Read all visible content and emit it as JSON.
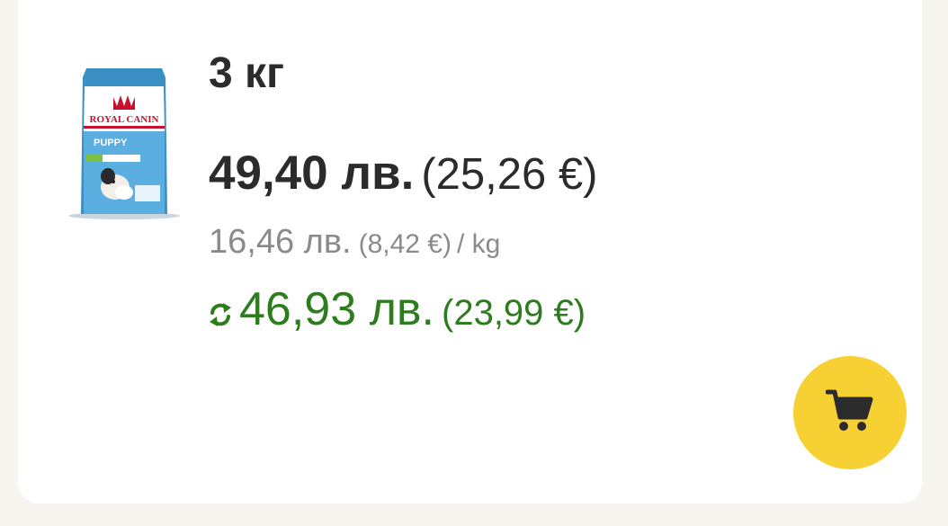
{
  "product": {
    "image_icon": "royal-canin-puppy-bag-image",
    "brand_text": "ROYAL CANIN",
    "bag_label": "PUPPY",
    "size": "3 кг"
  },
  "price": {
    "bgn": "49,40 лв.",
    "eur": "(25,26 €)"
  },
  "unit_price": {
    "bgn": "16,46 лв.",
    "eur": "(8,42 €)",
    "per": "/ kg"
  },
  "subscription_price": {
    "icon": "repeat-subscribe-icon",
    "bgn": "46,93 лв.",
    "eur": "(23,99 €)"
  },
  "cart": {
    "icon": "shopping-cart-icon"
  },
  "colors": {
    "accent_yellow": "#f7d133",
    "subscribe_green": "#2d7d1e",
    "text_dark": "#2b2b2b",
    "text_muted": "#8a8a8a"
  }
}
